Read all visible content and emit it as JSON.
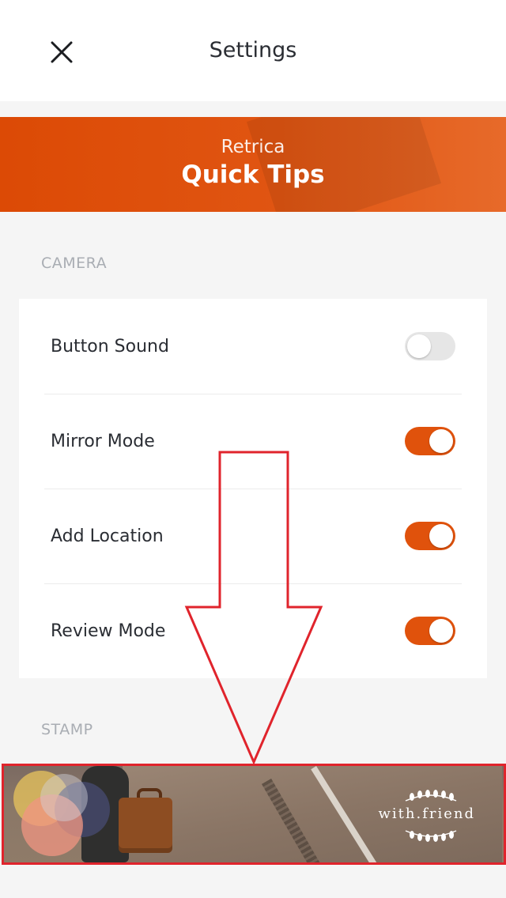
{
  "header": {
    "title": "Settings",
    "close_icon": "close-icon"
  },
  "banner": {
    "subtitle": "Retrica",
    "title": "Quick Tips"
  },
  "sections": {
    "camera": "CAMERA",
    "stamp": "STAMP"
  },
  "camera_settings": [
    {
      "label": "Button Sound",
      "enabled": false
    },
    {
      "label": "Mirror Mode",
      "enabled": true
    },
    {
      "label": "Add Location",
      "enabled": true
    },
    {
      "label": "Review Mode",
      "enabled": true
    }
  ],
  "stamp_preview": {
    "text": "with.friend"
  },
  "colors": {
    "accent": "#e0520c",
    "toggle_off": "#e6e6e6",
    "annotation": "#e0242c"
  }
}
